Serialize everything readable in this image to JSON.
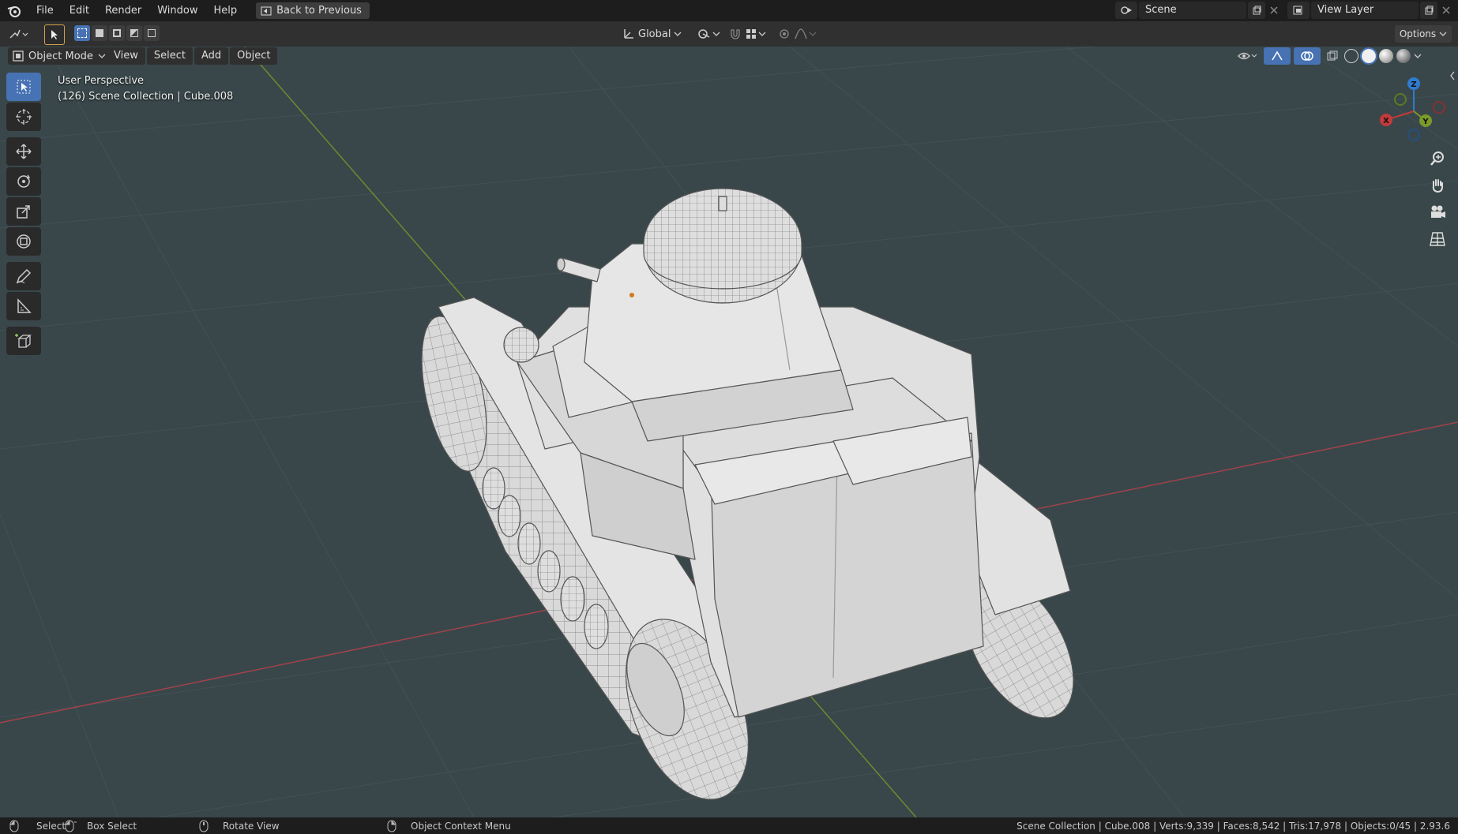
{
  "menu": [
    "File",
    "Edit",
    "Render",
    "Window",
    "Help"
  ],
  "back_button": "Back to Previous",
  "scene": {
    "label": "Scene",
    "view_layer": "View Layer"
  },
  "header": {
    "mode": "Object Mode",
    "menus": [
      "View",
      "Select",
      "Add",
      "Object"
    ],
    "transform_orientation": "Global",
    "options": "Options"
  },
  "viewport": {
    "perspective": "User Perspective",
    "collection_info": "(126) Scene Collection | Cube.008"
  },
  "gizmo": {
    "x": "X",
    "y": "Y",
    "z": "Z"
  },
  "status": {
    "select": "Select",
    "box_select": "Box Select",
    "rotate_view": "Rotate View",
    "context_menu": "Object Context Menu",
    "stats": "Scene Collection | Cube.008 | Verts:9,339 | Faces:8,542 | Tris:17,978 | Objects:0/45 | 2.93.6"
  },
  "colors": {
    "accent": "#4772b3",
    "x_axis": "#c43a3a",
    "y_axis": "#7a9a2a",
    "z_axis": "#2f7bd0",
    "viewport_bg": "#39474a"
  }
}
